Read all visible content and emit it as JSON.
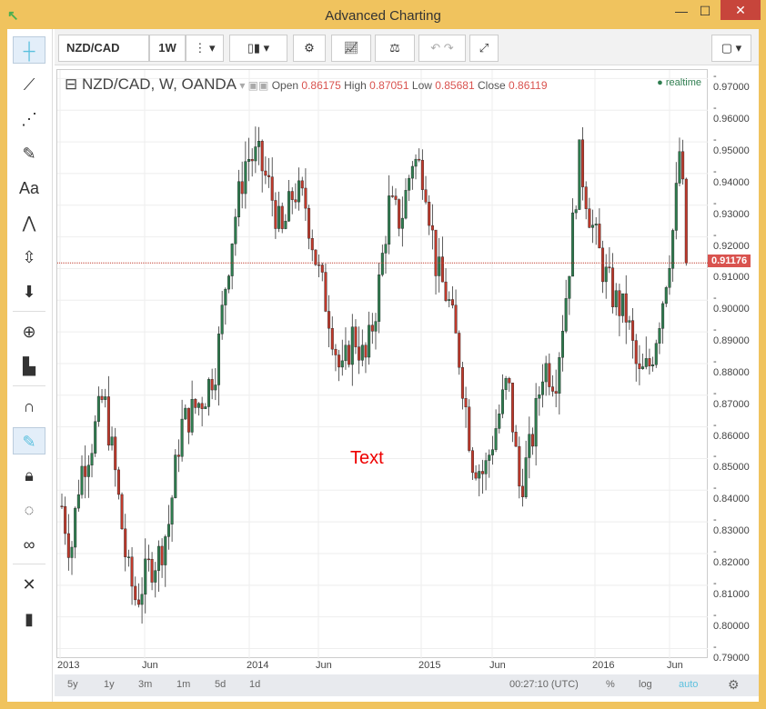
{
  "window": {
    "title": "Advanced Charting",
    "minimize": "—",
    "maximize": "☐",
    "close": "✕"
  },
  "toolbar": {
    "symbol": "NZD/CAD",
    "interval": "1W"
  },
  "legend": {
    "title": "NZD/CAD, W, OANDA",
    "open_label": "Open",
    "open": "0.86175",
    "high_label": "High",
    "high": "0.87051",
    "low_label": "Low",
    "low": "0.85681",
    "close_label": "Close",
    "close": "0.86119",
    "realtime": "realtime"
  },
  "annotation": "Text",
  "colors": {
    "up": "#2e7d4f",
    "down": "#c0392b",
    "frame": "#f0c35e",
    "accent": "#5bc0de"
  },
  "bottom": {
    "ranges": [
      "5y",
      "1y",
      "3m",
      "1m",
      "5d",
      "1d"
    ],
    "time": "00:27:10 (UTC)",
    "percent": "%",
    "log": "log",
    "auto": "auto"
  },
  "chart_data": {
    "type": "candlestick",
    "title": "NZD/CAD, W, OANDA",
    "price_ticks": [
      "0.97000",
      "0.96000",
      "0.95000",
      "0.94000",
      "0.93000",
      "0.92000",
      "0.91000",
      "0.90000",
      "0.89000",
      "0.88000",
      "0.87000",
      "0.86000",
      "0.85000",
      "0.84000",
      "0.83000",
      "0.82000",
      "0.81000",
      "0.80000",
      "0.79000"
    ],
    "ylim": [
      0.7867,
      0.9727
    ],
    "x_ticks": [
      "2013",
      "Jun",
      "2014",
      "Jun",
      "2015",
      "Jun",
      "2016",
      "Jun"
    ],
    "current_price": "0.91176",
    "close_path_weeks": [
      0,
      3,
      6,
      10,
      14,
      18,
      22,
      25,
      29,
      33,
      36,
      40,
      44,
      48,
      52,
      55,
      58,
      62,
      66,
      70,
      74,
      78,
      82,
      86,
      90,
      94,
      98,
      102,
      106,
      110,
      114,
      118,
      122,
      126,
      130,
      134,
      138,
      142,
      146,
      150,
      154,
      158,
      162,
      166,
      170,
      174,
      178,
      182,
      186,
      190,
      194,
      198,
      202,
      206,
      208,
      210
    ],
    "close_path_values": [
      0.835,
      0.82,
      0.845,
      0.855,
      0.87,
      0.845,
      0.815,
      0.805,
      0.815,
      0.82,
      0.83,
      0.86,
      0.865,
      0.87,
      0.88,
      0.905,
      0.925,
      0.945,
      0.945,
      0.935,
      0.92,
      0.935,
      0.93,
      0.91,
      0.895,
      0.875,
      0.89,
      0.88,
      0.9,
      0.93,
      0.925,
      0.945,
      0.94,
      0.91,
      0.9,
      0.88,
      0.85,
      0.845,
      0.86,
      0.875,
      0.84,
      0.855,
      0.88,
      0.875,
      0.905,
      0.945,
      0.925,
      0.91,
      0.9,
      0.895,
      0.875,
      0.88,
      0.9,
      0.925,
      0.95,
      0.912
    ]
  }
}
